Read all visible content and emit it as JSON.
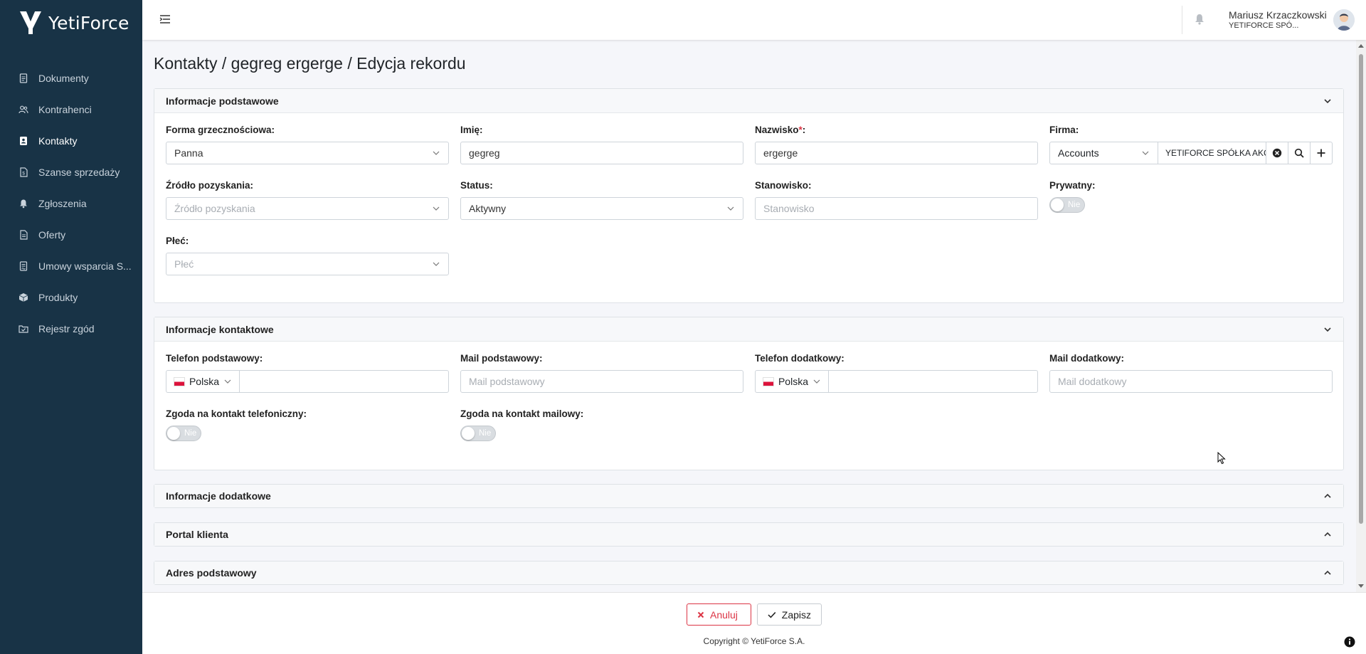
{
  "brand": {
    "name": "YetiForce"
  },
  "sidebar": {
    "items": [
      {
        "label": "Dokumenty",
        "icon": "document-icon"
      },
      {
        "label": "Kontrahenci",
        "icon": "accounts-icon"
      },
      {
        "label": "Kontakty",
        "icon": "contact-icon",
        "active": true
      },
      {
        "label": "Szanse sprzedaży",
        "icon": "opportunity-icon"
      },
      {
        "label": "Zgłoszenia",
        "icon": "bell-icon"
      },
      {
        "label": "Oferty",
        "icon": "offer-icon"
      },
      {
        "label": "Umowy wsparcia S...",
        "icon": "contract-icon"
      },
      {
        "label": "Produkty",
        "icon": "product-icon"
      },
      {
        "label": "Rejestr zgód",
        "icon": "consent-icon"
      }
    ]
  },
  "header": {
    "user_name": "Mariusz Krzaczkowski",
    "user_company": "YETIFORCE SPÓ..."
  },
  "page_title": "Kontakty / gegreg ergerge / Edycja rekordu",
  "sections": {
    "basic": {
      "title": "Informacje podstawowe",
      "salutation": {
        "label": "Forma grzecznościowa:",
        "value": "Panna"
      },
      "first_name": {
        "label": "Imię:",
        "value": "gegreg"
      },
      "last_name": {
        "label": "Nazwisko",
        "required": "*",
        "suffix": ":",
        "value": "ergerge"
      },
      "company": {
        "label": "Firma:",
        "type": "Accounts",
        "value": "YETIFORCE SPÓŁKA AKCYJNA"
      },
      "lead_source": {
        "label": "Źródło pozyskania:",
        "placeholder": "Źródło pozyskania"
      },
      "status": {
        "label": "Status:",
        "value": "Aktywny"
      },
      "position": {
        "label": "Stanowisko:",
        "placeholder": "Stanowisko"
      },
      "private": {
        "label": "Prywatny:",
        "toggle": "Nie"
      },
      "gender": {
        "label": "Płeć:",
        "placeholder": "Płeć"
      }
    },
    "contact": {
      "title": "Informacje kontaktowe",
      "phone": {
        "label": "Telefon podstawowy:",
        "country": "Polska"
      },
      "email": {
        "label": "Mail podstawowy:",
        "placeholder": "Mail podstawowy"
      },
      "phone2": {
        "label": "Telefon dodatkowy:",
        "country": "Polska"
      },
      "email2": {
        "label": "Mail dodatkowy:",
        "placeholder": "Mail dodatkowy"
      },
      "phone_consent": {
        "label": "Zgoda na kontakt telefoniczny:",
        "toggle": "Nie"
      },
      "email_consent": {
        "label": "Zgoda na kontakt mailowy:",
        "toggle": "Nie"
      }
    },
    "additional": {
      "title": "Informacje dodatkowe"
    },
    "portal": {
      "title": "Portal klienta"
    },
    "address": {
      "title": "Adres podstawowy"
    }
  },
  "footer": {
    "cancel_label": "Anuluj",
    "save_label": "Zapisz",
    "copyright": "Copyright © YetiForce S.A."
  },
  "colors": {
    "sidebar_bg": "#183346",
    "danger": "#dc3545",
    "panel_head_bg": "#f7f8fa"
  }
}
